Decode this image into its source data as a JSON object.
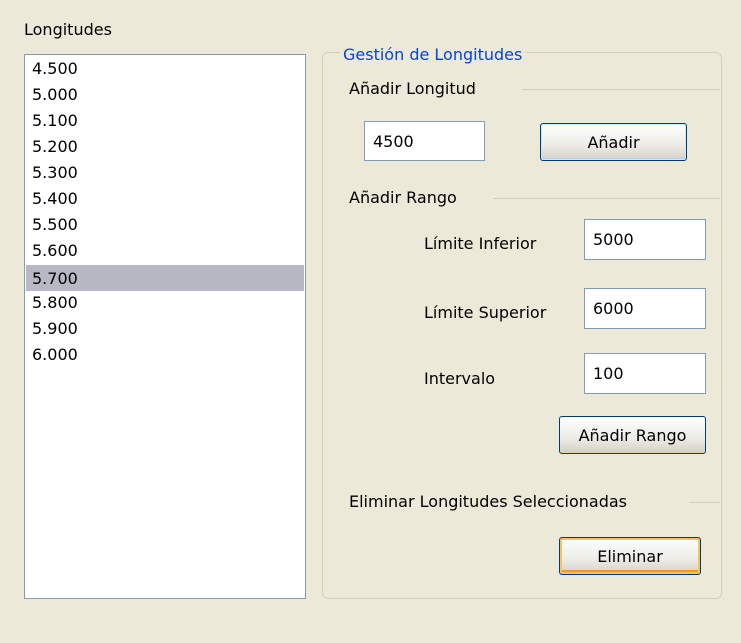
{
  "longitudes_panel": {
    "title": "Longitudes",
    "items": [
      "4.500",
      "5.000",
      "5.100",
      "5.200",
      "5.300",
      "5.400",
      "5.500",
      "5.600",
      "5.700",
      "5.800",
      "5.900",
      "6.000"
    ],
    "selected_item": "5.700"
  },
  "gestion": {
    "legend": "Gestión de Longitudes",
    "add_length": {
      "label": "Añadir Longitud",
      "value": "4500",
      "button": "Añadir"
    },
    "add_range": {
      "label": "Añadir Rango",
      "lower_label": "Límite Inferior",
      "lower_value": "5000",
      "upper_label": "Límite Superior",
      "upper_value": "6000",
      "interval_label": "Intervalo",
      "interval_value": "100",
      "button": "Añadir Rango"
    },
    "delete": {
      "label": "Eliminar Longitudes Seleccionadas",
      "button": "Eliminar"
    }
  },
  "colors": {
    "background": "#ece9d8",
    "legend": "#0046d5",
    "selection": "#b7b8c3",
    "input_border": "#7f9db9",
    "button_border": "#003c74"
  }
}
